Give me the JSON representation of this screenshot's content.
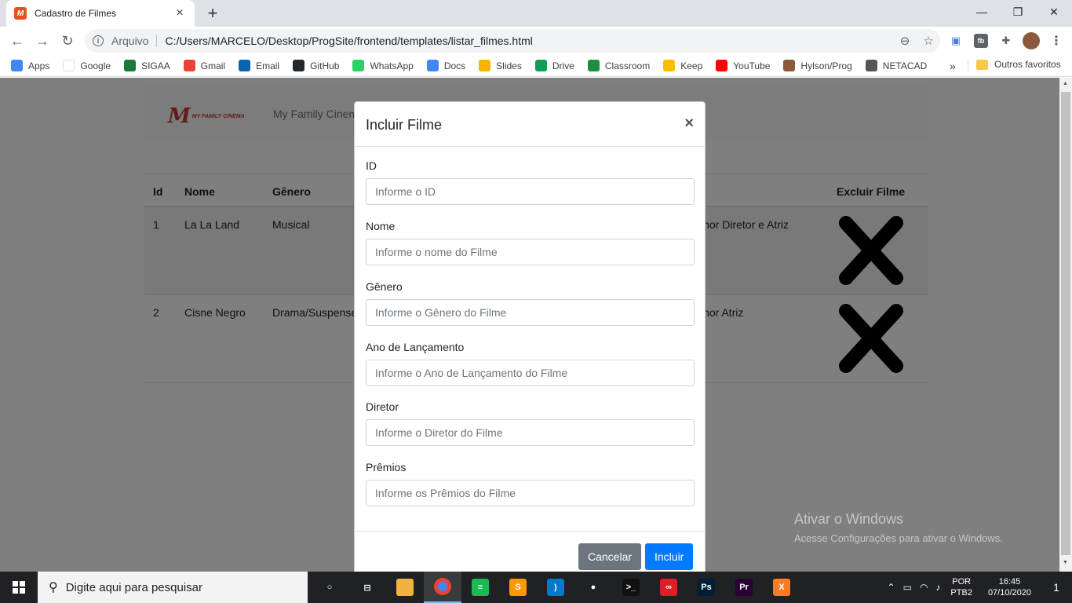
{
  "browser": {
    "tab_title": "Cadastro de Filmes",
    "tab_close": "×",
    "new_tab": "+",
    "window_controls": {
      "minimize": "—",
      "maximize": "❐",
      "close": "✕"
    },
    "scheme_label": "Arquivo",
    "url": "C:/Users/MARCELO/Desktop/ProgSite/frontend/templates/listar_filmes.html"
  },
  "bookmarks": {
    "items": [
      {
        "label": "Apps",
        "color": "#4285f4"
      },
      {
        "label": "Google",
        "color": "#ffffff"
      },
      {
        "label": "SIGAA",
        "color": "#1b7a3a"
      },
      {
        "label": "Gmail",
        "color": "#ea4335"
      },
      {
        "label": "Email",
        "color": "#0a64ad"
      },
      {
        "label": "GitHub",
        "color": "#24292e"
      },
      {
        "label": "WhatsApp",
        "color": "#25d366"
      },
      {
        "label": "Docs",
        "color": "#4285f4"
      },
      {
        "label": "Slides",
        "color": "#f4b400"
      },
      {
        "label": "Drive",
        "color": "#0f9d58"
      },
      {
        "label": "Classroom",
        "color": "#1e8e3e"
      },
      {
        "label": "Keep",
        "color": "#fbbc04"
      },
      {
        "label": "YouTube",
        "color": "#ff0000"
      },
      {
        "label": "Hylson/Prog",
        "color": "#8b5a3c"
      },
      {
        "label": "NETACAD",
        "color": "#555555"
      }
    ],
    "more": "»",
    "other_favorites": "Outros favoritos"
  },
  "page": {
    "brand": "My Family Cinema",
    "logo_tagline": "MY FAMILY CINEMA",
    "table": {
      "headers": [
        "Id",
        "Nome",
        "Gênero",
        "Excluir Filme"
      ],
      "rows": [
        {
          "id": "1",
          "nome": "La La Land",
          "genero": "Musical",
          "premios": "lhor Diretor e Atriz"
        },
        {
          "id": "2",
          "nome": "Cisne Negro",
          "genero": "Drama/Suspense",
          "premios": "lhor Atriz"
        }
      ]
    }
  },
  "modal": {
    "title": "Incluir Filme",
    "close": "×",
    "fields": [
      {
        "label": "ID",
        "placeholder": "Informe o ID"
      },
      {
        "label": "Nome",
        "placeholder": "Informe o nome do Filme"
      },
      {
        "label": "Gênero",
        "placeholder": "Informe o Gênero do Filme"
      },
      {
        "label": "Ano de Lançamento",
        "placeholder": "Informe o Ano de Lançamento do Filme"
      },
      {
        "label": "Diretor",
        "placeholder": "Informe o Diretor do Filme"
      },
      {
        "label": "Prêmios",
        "placeholder": "Informe os Prêmios do Filme"
      }
    ],
    "cancel_label": "Cancelar",
    "submit_label": "Incluir"
  },
  "watermark": {
    "line1": "Ativar o Windows",
    "line2": "Acesse Configurações para ativar o Windows."
  },
  "taskbar": {
    "search_placeholder": "Digite aqui para pesquisar",
    "apps": [
      {
        "name": "task-view",
        "color": "#202124",
        "glyph": "○"
      },
      {
        "name": "cortana",
        "color": "#202124",
        "glyph": "⊟"
      },
      {
        "name": "file-explorer",
        "color": "#f2b33d",
        "glyph": ""
      },
      {
        "name": "chrome",
        "color": "#4285f4",
        "glyph": ""
      },
      {
        "name": "spotify",
        "color": "#1db954",
        "glyph": "≡"
      },
      {
        "name": "sublime-text",
        "color": "#ff9800",
        "glyph": "S"
      },
      {
        "name": "vscode",
        "color": "#007acc",
        "glyph": "⟩"
      },
      {
        "name": "github-desktop",
        "color": "#202124",
        "glyph": "●"
      },
      {
        "name": "terminal",
        "color": "#111111",
        "glyph": ">_"
      },
      {
        "name": "creative-cloud",
        "color": "#da1f26",
        "glyph": "∞"
      },
      {
        "name": "photoshop",
        "color": "#001e36",
        "glyph": "Ps"
      },
      {
        "name": "premiere",
        "color": "#2a0034",
        "glyph": "Pr"
      },
      {
        "name": "xampp",
        "color": "#fb7a24",
        "glyph": "X"
      }
    ],
    "lang_line1": "POR",
    "lang_line2": "PTB2",
    "time": "16:45",
    "date": "07/10/2020",
    "notifications": "1"
  }
}
